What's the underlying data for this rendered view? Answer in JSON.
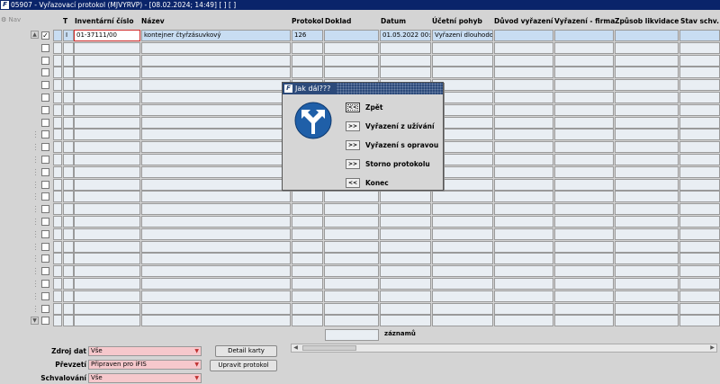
{
  "window": {
    "title": "05907 - Vyřazovací protokol (MJVYRVP) - [08.02.2024; 14:49] [ ] [ ]"
  },
  "nav": {
    "label": "Nav"
  },
  "columns": {
    "t": "T",
    "inventarni": "Inventární číslo",
    "nazev": "Název",
    "protokol": "Protokol",
    "doklad": "Doklad",
    "datum": "Datum",
    "ucetni": "Účetní pohyb",
    "duvod": "Důvod vyřazení",
    "firma": "Vyřazení - firma",
    "zpusob": "Způsob likvidace",
    "stav": "Stav schv."
  },
  "active_row": {
    "checked": "✓",
    "t": "I",
    "inventarni": "01-37111/00",
    "nazev": "kontejner čtyřzásuvkový",
    "protokol": "126",
    "doklad": "",
    "datum": "01.05.2022 00:0",
    "ucetni": "Vyřazení dlouhodol",
    "duvod": "",
    "firma": "",
    "zpusob": "",
    "stav": ""
  },
  "footer": {
    "zaznamu_label": "záznamů",
    "zdroj_label": "Zdroj dat",
    "zdroj_value": "Vše",
    "prevzeti_label": "Převzetí",
    "prevzeti_value": "Připraven pro iFIS",
    "schvalovani_label": "Schvalování",
    "schvalovani_value": "Vše",
    "detail_button": "Detail karty",
    "upravit_button": "Upravit protokol"
  },
  "dialog": {
    "title": "Jak dál???",
    "options": [
      {
        "button": "<<",
        "label": "Zpět"
      },
      {
        "button": ">>",
        "label": "Vyřazení z užívání"
      },
      {
        "button": ">>",
        "label": "Vyřazení s opravou"
      },
      {
        "button": ">>",
        "label": "Storno protokolu"
      },
      {
        "button": "<<",
        "label": "Konec"
      }
    ]
  },
  "colors": {
    "titlebar": "#0a246a",
    "cell": "#e9eef3",
    "active_row": "#c8ddf2",
    "required_field": "#f6c8cc",
    "dialog_title": "#2c4a7a"
  }
}
